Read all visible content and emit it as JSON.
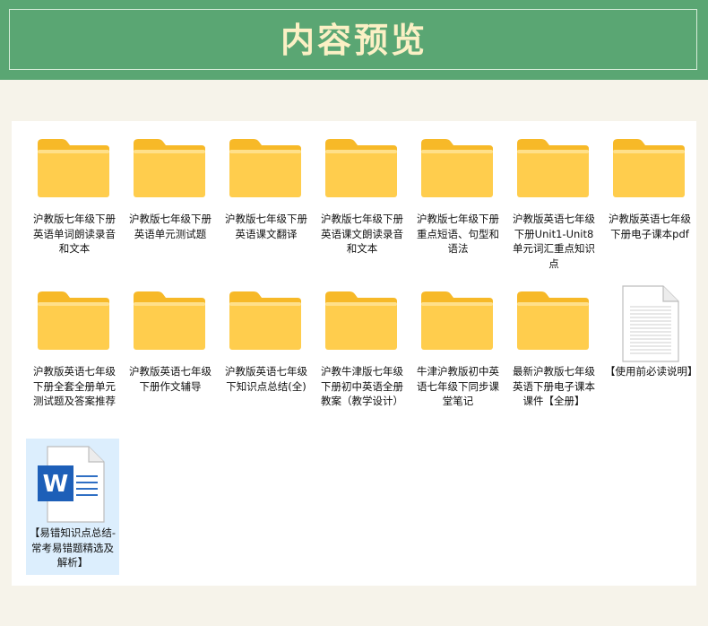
{
  "header": {
    "title": "内容预览"
  },
  "files": [
    {
      "label": "沪教版七年级下册英语单词朗读录音和文本",
      "type": "folder"
    },
    {
      "label": "沪教版七年级下册英语单元测试题",
      "type": "folder"
    },
    {
      "label": "沪教版七年级下册英语课文翻译",
      "type": "folder"
    },
    {
      "label": "沪教版七年级下册英语课文朗读录音和文本",
      "type": "folder"
    },
    {
      "label": "沪教版七年级下册重点短语、句型和语法",
      "type": "folder"
    },
    {
      "label": "沪教版英语七年级下册Unit1-Unit8单元词汇重点知识点",
      "type": "folder"
    },
    {
      "label": "沪教版英语七年级下册电子课本pdf",
      "type": "folder"
    },
    {
      "label": "沪教版英语七年级下册全套全册单元测试题及答案推荐",
      "type": "folder"
    },
    {
      "label": "沪教版英语七年级下册作文辅导",
      "type": "folder"
    },
    {
      "label": "沪教版英语七年级下知识点总结(全)",
      "type": "folder"
    },
    {
      "label": "沪教牛津版七年级下册初中英语全册教案（教学设计）",
      "type": "folder"
    },
    {
      "label": "牛津沪教版初中英语七年级下同步课堂笔记",
      "type": "folder"
    },
    {
      "label": "最新沪教版七年级英语下册电子课本课件【全册】",
      "type": "folder"
    },
    {
      "label": "【使用前必读说明】",
      "type": "text-document"
    },
    {
      "label": "【易错知识点总结-常考易错题精选及解析】",
      "type": "word-document",
      "selected": true
    }
  ],
  "icons": {
    "folder": "folder-icon",
    "text-document": "text-document-icon",
    "word-document": "word-document-icon"
  },
  "colors": {
    "banner": "#5aa673",
    "title": "#fbf0c5",
    "folder": "#ffcd4d",
    "selection": "#dceefd",
    "word": "#1d5fb8"
  }
}
